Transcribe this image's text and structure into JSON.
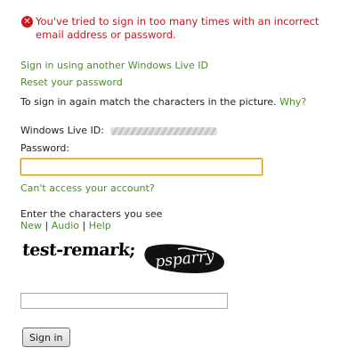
{
  "error": {
    "icon": "error-x-icon",
    "color": "#c8161d",
    "message": "You've tried to sign in too many times with an incorrect email address or password."
  },
  "links": {
    "sign_in_another": "Sign in using another Windows Live ID",
    "reset_password": "Reset your password",
    "why": "Why?",
    "cant_access": "Can't access your account?"
  },
  "instructions": {
    "match_characters": "To sign in again match the characters in the picture."
  },
  "account": {
    "id_label": "Windows Live ID:",
    "password_label": "Password:",
    "password_value": "",
    "id_value_obscured": true
  },
  "captcha": {
    "prompt": "Enter the characters you see",
    "new": "New",
    "audio": "Audio",
    "help": "Help",
    "separator": "|",
    "image_text_1": "test-remark;",
    "image_text_2": "psparry",
    "input_value": ""
  },
  "buttons": {
    "sign_in": "Sign in"
  },
  "colors": {
    "link": "#4a8d2d",
    "focus_border": "#d49a16"
  }
}
